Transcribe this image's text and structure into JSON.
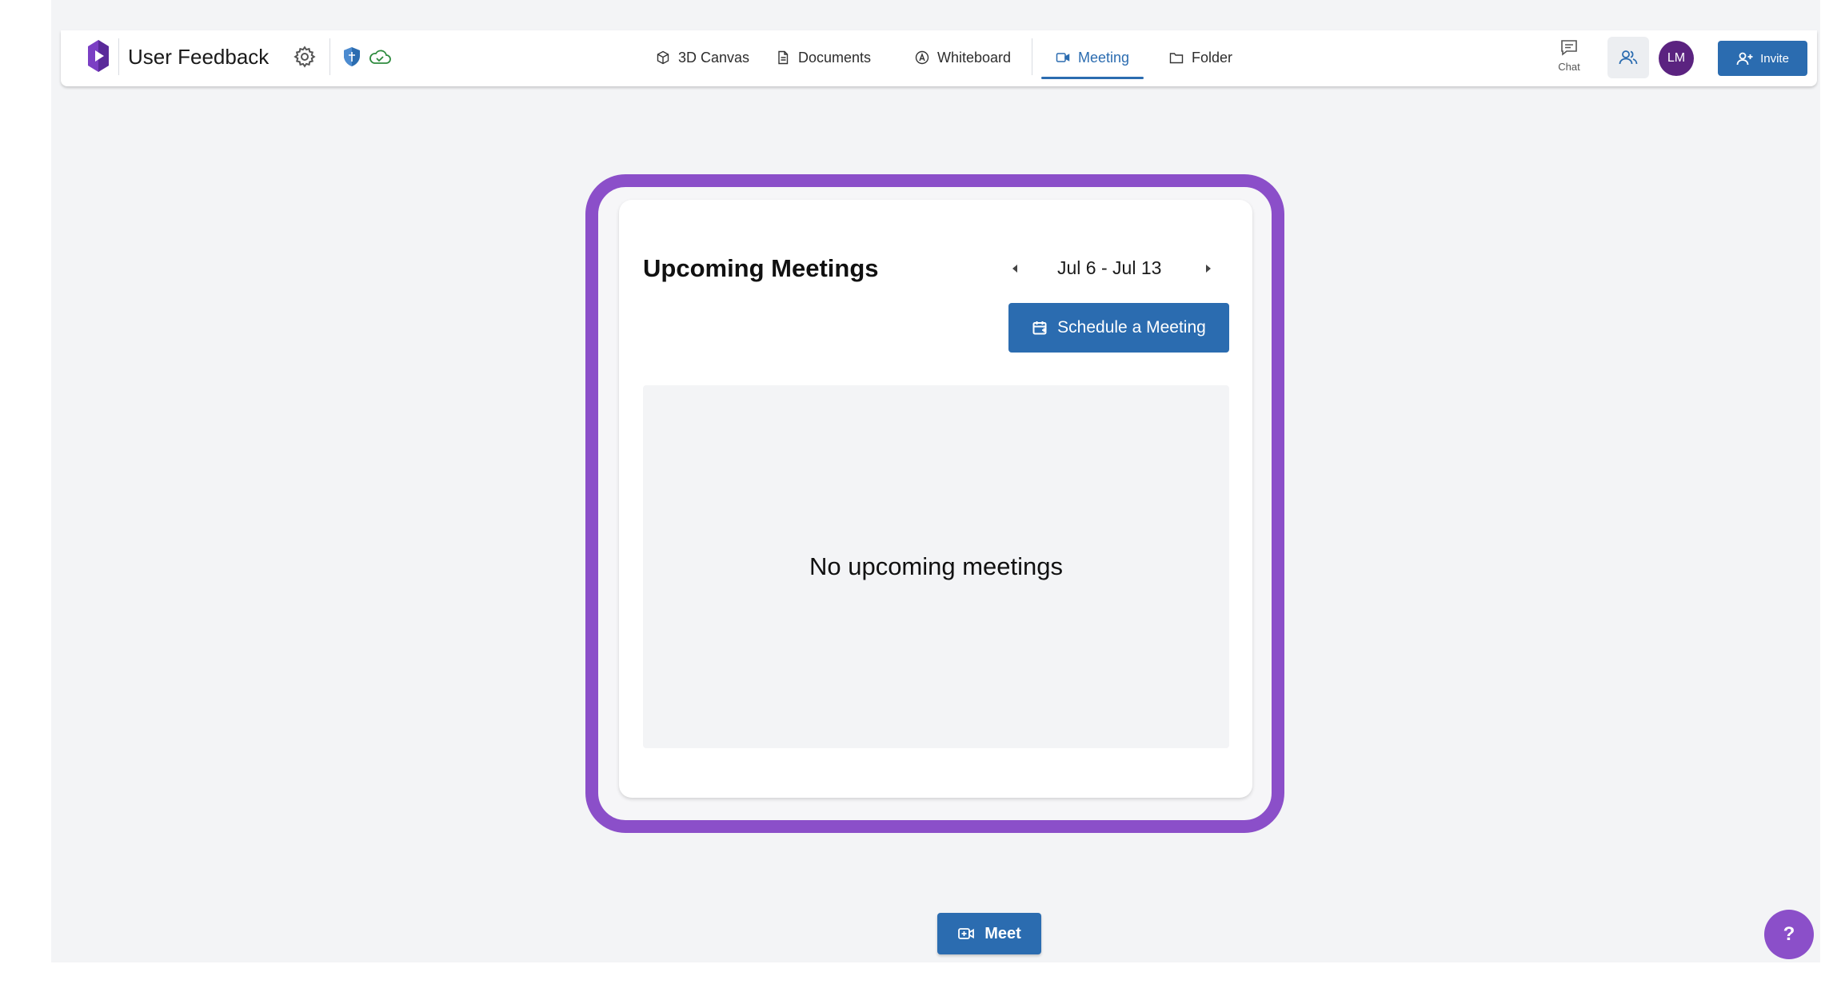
{
  "header": {
    "title": "User Feedback",
    "tabs": [
      {
        "label": "3D Canvas",
        "icon": "cube-icon"
      },
      {
        "label": "Documents",
        "icon": "document-icon"
      },
      {
        "label": "Whiteboard",
        "icon": "pen-circle-icon"
      },
      {
        "label": "Meeting",
        "icon": "video-icon",
        "active": true
      },
      {
        "label": "Folder",
        "icon": "folder-icon"
      }
    ],
    "chat_label": "Chat",
    "avatar_initials": "LM",
    "invite_label": "Invite"
  },
  "meetings": {
    "title": "Upcoming Meetings",
    "date_range": "Jul 6 - Jul 13",
    "schedule_label": "Schedule a Meeting",
    "empty_text": "No upcoming meetings"
  },
  "meet_label": "Meet",
  "help_label": "?",
  "colors": {
    "accent": "#2b6cb0",
    "highlight": "#8b4fc9",
    "avatar": "#5b2380",
    "background": "#f3f4f6"
  }
}
